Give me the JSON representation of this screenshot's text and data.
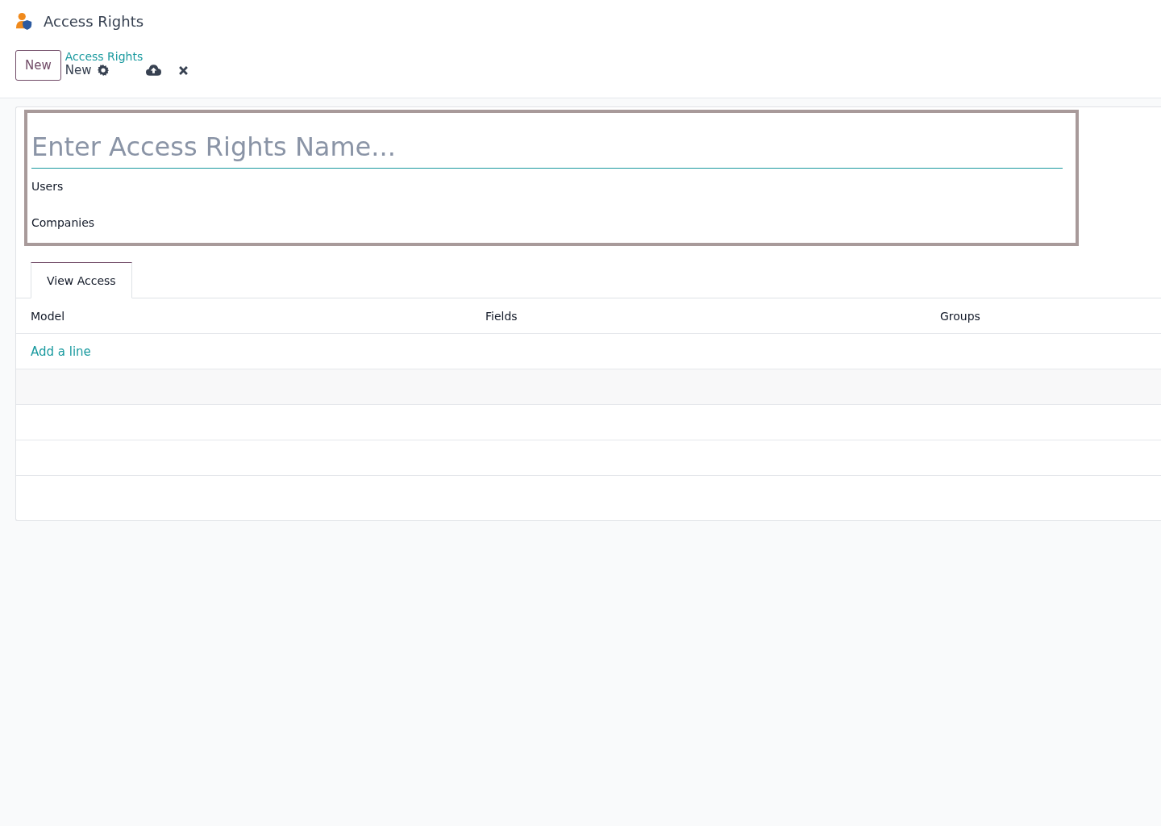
{
  "app": {
    "title": "Access Rights"
  },
  "control_panel": {
    "new_button": "New",
    "breadcrumb": "Access Rights",
    "record": "New"
  },
  "form": {
    "name": {
      "placeholder": "Enter Access Rights Name..."
    },
    "fields": [
      {
        "label": "Users"
      },
      {
        "label": "Companies"
      }
    ],
    "tabs": [
      {
        "label": "View Access",
        "selected": true
      }
    ],
    "table": {
      "columns": [
        "Model",
        "Fields",
        "Groups"
      ],
      "add_line": "Add a line"
    }
  }
}
